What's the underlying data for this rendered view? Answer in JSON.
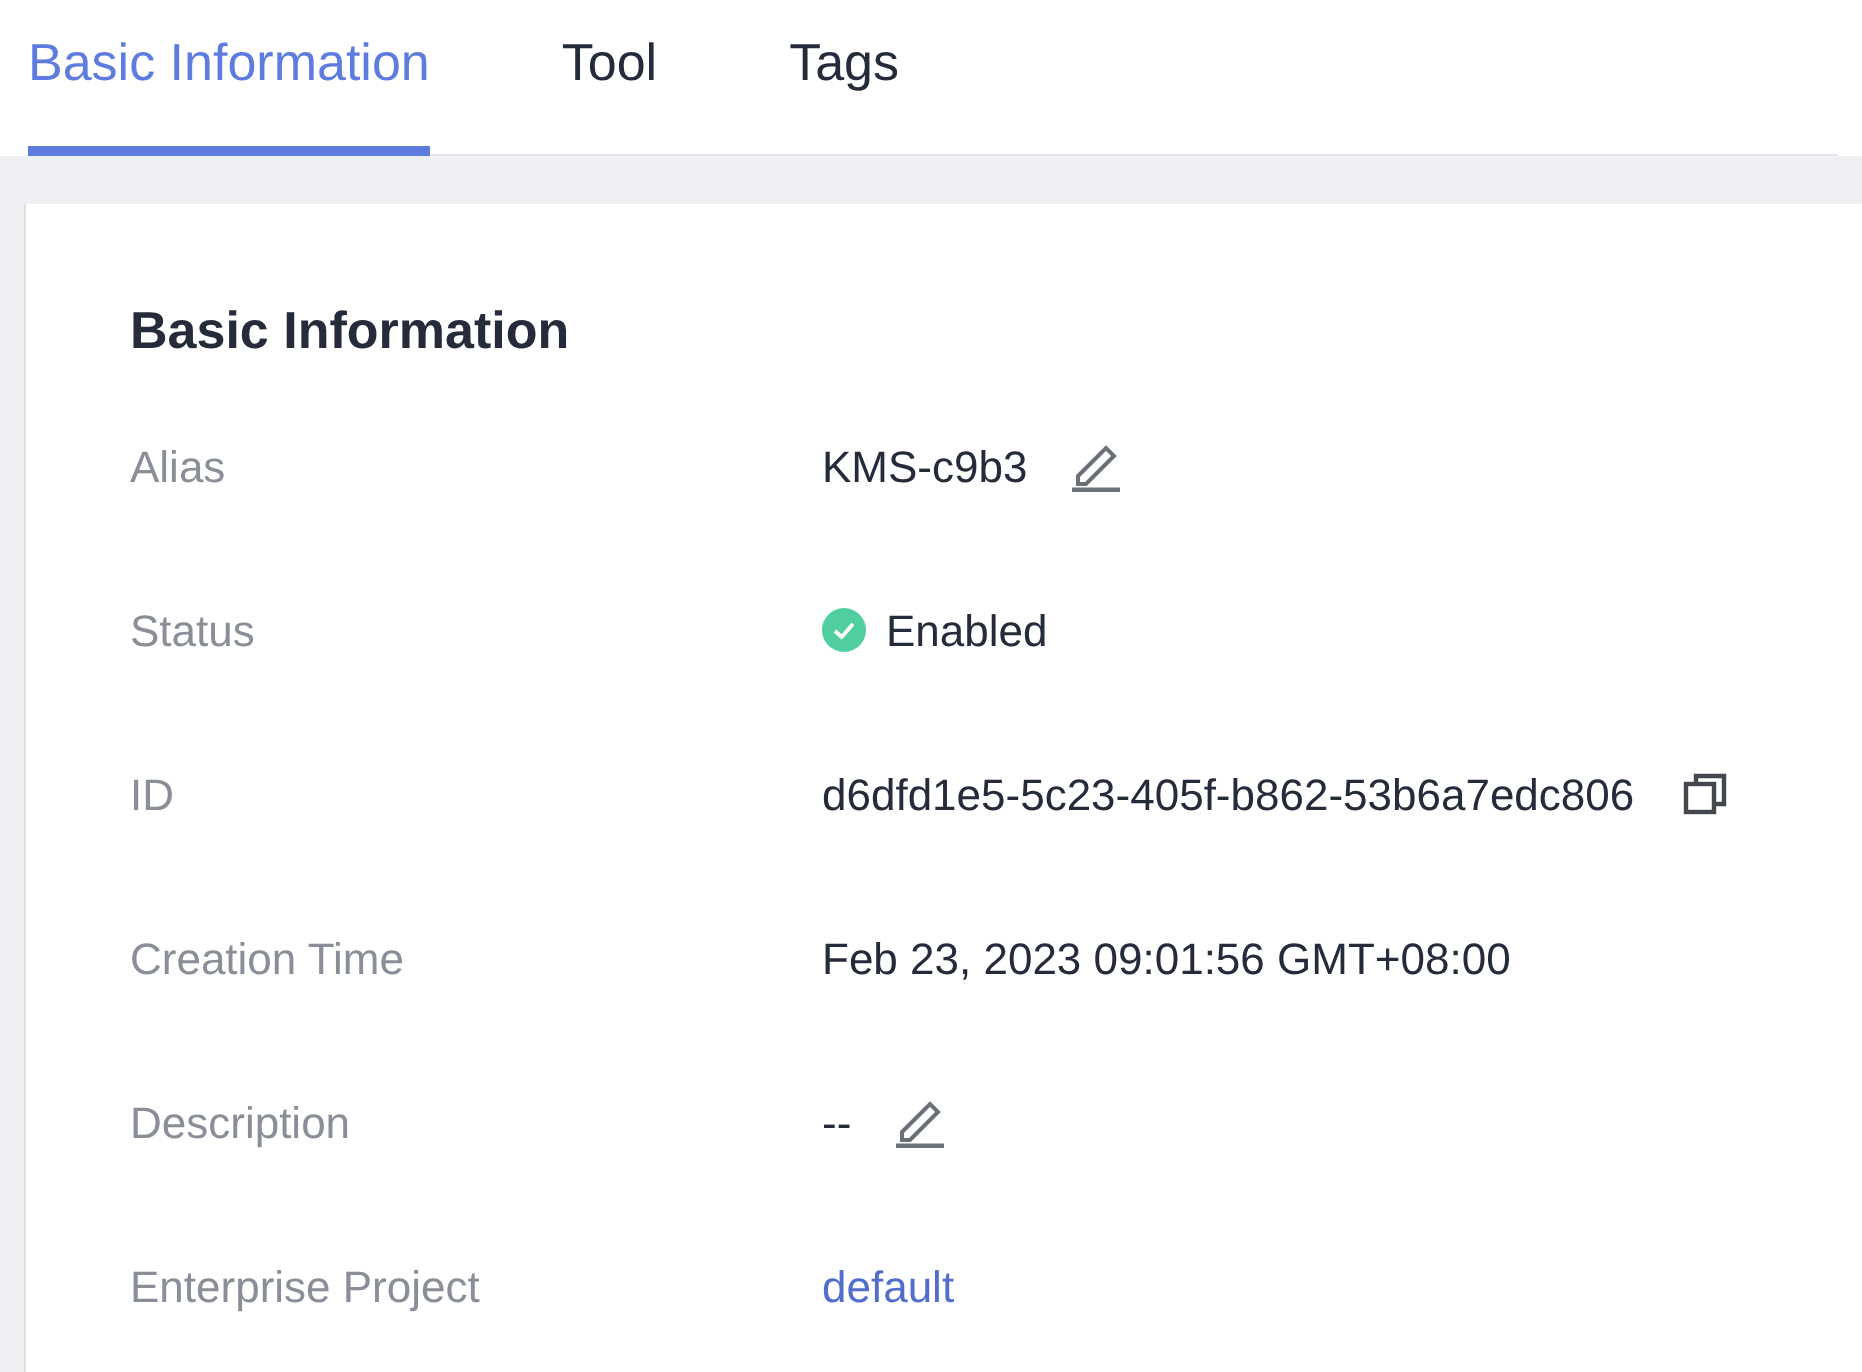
{
  "tabs": [
    {
      "label": "Basic Information",
      "selected": true
    },
    {
      "label": "Tool",
      "selected": false
    },
    {
      "label": "Tags",
      "selected": false
    }
  ],
  "section": {
    "title": "Basic Information"
  },
  "rows": [
    {
      "label": "Alias",
      "value": "KMS-c9b3",
      "kind": "editable"
    },
    {
      "label": "Status",
      "value": "Enabled",
      "kind": "status",
      "color": "#4fcf9f"
    },
    {
      "label": "ID",
      "value": "d6dfd1e5-5c23-405f-b862-53b6a7edc806",
      "kind": "copyable"
    },
    {
      "label": "Creation Time",
      "value": "Feb 23, 2023 09:01:56 GMT+08:00",
      "kind": "plain"
    },
    {
      "label": "Description",
      "value": "--",
      "kind": "editable"
    },
    {
      "label": "Enterprise Project",
      "value": "default",
      "kind": "link"
    }
  ]
}
